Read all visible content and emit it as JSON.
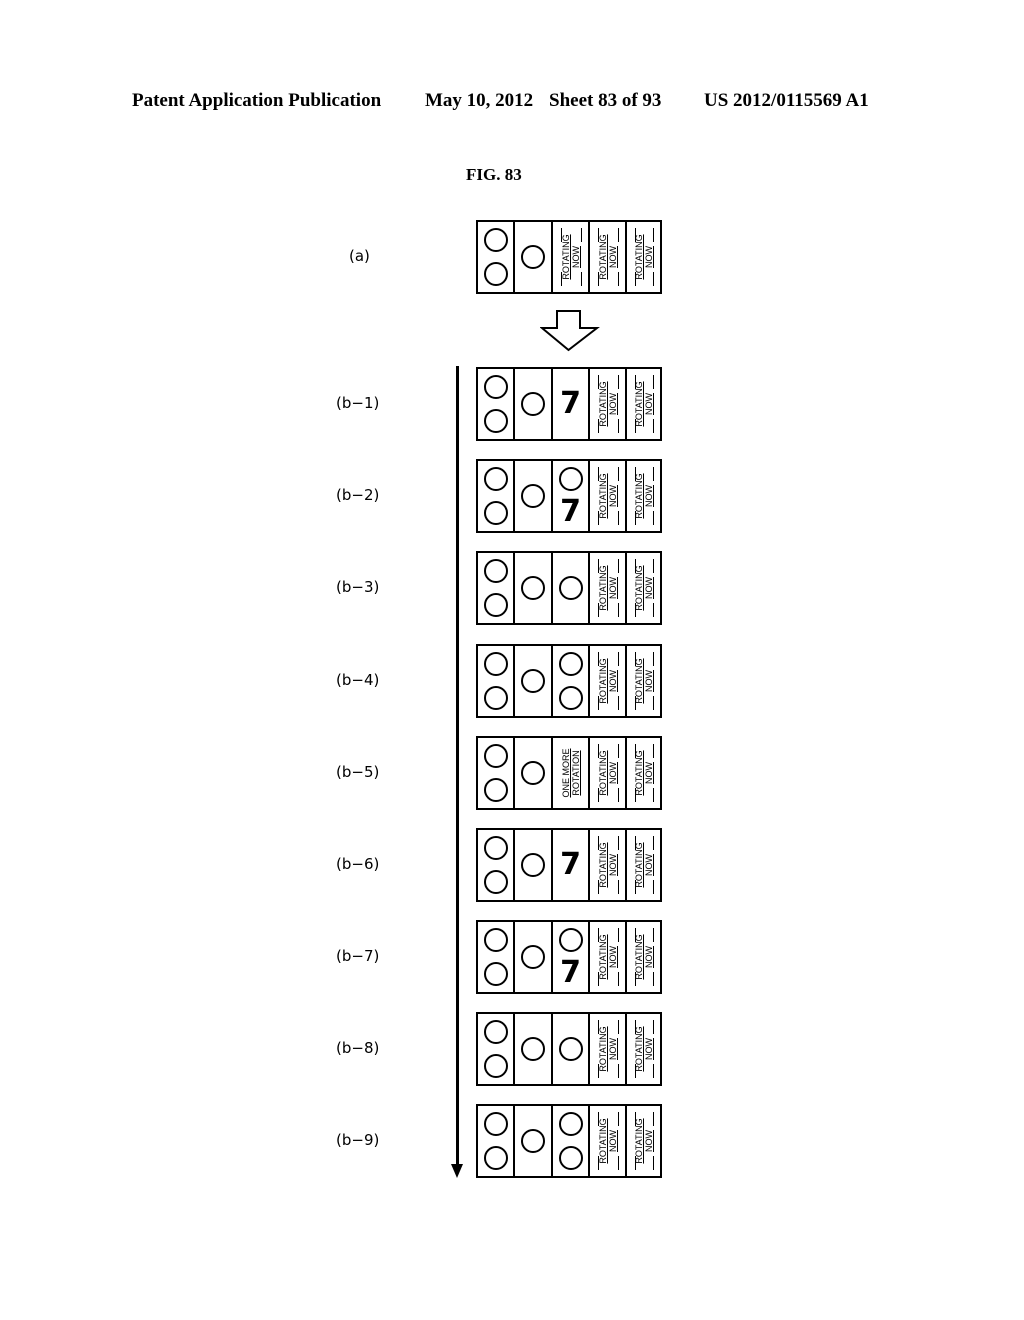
{
  "header": {
    "publication": "Patent Application Publication",
    "date": "May 10, 2012",
    "sheet": "Sheet 83 of 93",
    "number": "US 2012/0115569 A1"
  },
  "figure": {
    "title": "FIG. 83",
    "transition_icon": "hollow-down-arrow",
    "timeline_icon": "down-arrow-line"
  },
  "text": {
    "rotating_line1": "ROTATING",
    "rotating_line2": "NOW",
    "one_more_line1": "ONE MORE",
    "one_more_line2": "ROTATION",
    "seven": "7"
  },
  "panels": [
    {
      "label": "(a)",
      "reels": [
        [
          "circle",
          "circle"
        ],
        [
          "circle"
        ],
        [
          "rotating"
        ],
        [
          "rotating"
        ],
        [
          "rotating"
        ]
      ]
    },
    {
      "label": "(b−1)",
      "reels": [
        [
          "circle",
          "circle"
        ],
        [
          "circle"
        ],
        [
          "seven"
        ],
        [
          "rotating"
        ],
        [
          "rotating"
        ]
      ]
    },
    {
      "label": "(b−2)",
      "reels": [
        [
          "circle",
          "circle"
        ],
        [
          "circle"
        ],
        [
          "circle",
          "seven"
        ],
        [
          "rotating"
        ],
        [
          "rotating"
        ]
      ]
    },
    {
      "label": "(b−3)",
      "reels": [
        [
          "circle",
          "circle"
        ],
        [
          "circle"
        ],
        [
          "circle"
        ],
        [
          "rotating"
        ],
        [
          "rotating"
        ]
      ]
    },
    {
      "label": "(b−4)",
      "reels": [
        [
          "circle",
          "circle"
        ],
        [
          "circle"
        ],
        [
          "circle",
          "circle"
        ],
        [
          "rotating"
        ],
        [
          "rotating"
        ]
      ]
    },
    {
      "label": "(b−5)",
      "reels": [
        [
          "circle",
          "circle"
        ],
        [
          "circle"
        ],
        [
          "one-more-rotation"
        ],
        [
          "rotating"
        ],
        [
          "rotating"
        ]
      ]
    },
    {
      "label": "(b−6)",
      "reels": [
        [
          "circle",
          "circle"
        ],
        [
          "circle"
        ],
        [
          "seven"
        ],
        [
          "rotating"
        ],
        [
          "rotating"
        ]
      ]
    },
    {
      "label": "(b−7)",
      "reels": [
        [
          "circle",
          "circle"
        ],
        [
          "circle"
        ],
        [
          "circle",
          "seven"
        ],
        [
          "rotating"
        ],
        [
          "rotating"
        ]
      ]
    },
    {
      "label": "(b−8)",
      "reels": [
        [
          "circle",
          "circle"
        ],
        [
          "circle"
        ],
        [
          "circle"
        ],
        [
          "rotating"
        ],
        [
          "rotating"
        ]
      ]
    },
    {
      "label": "(b−9)",
      "reels": [
        [
          "circle",
          "circle"
        ],
        [
          "circle"
        ],
        [
          "circle",
          "circle"
        ],
        [
          "rotating"
        ],
        [
          "rotating"
        ]
      ]
    }
  ]
}
